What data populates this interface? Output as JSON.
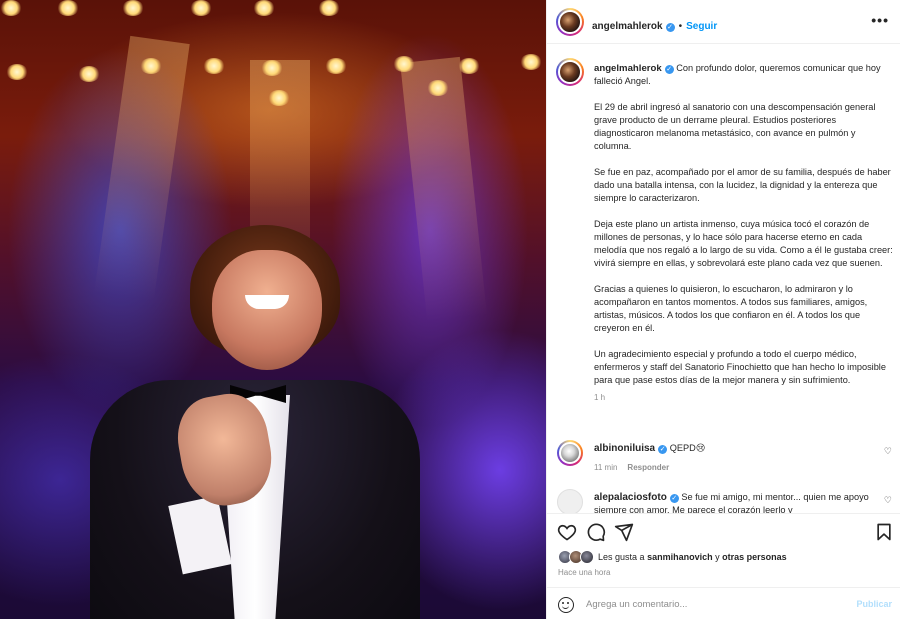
{
  "post": {
    "username": "angelmahlerok",
    "verified_icon": "verified-badge-icon",
    "separator": "•",
    "follow_label": "Seguir",
    "more_label": "•••"
  },
  "caption": {
    "username": "angelmahlerok",
    "paragraphs": [
      "Con profundo dolor, queremos comunicar que hoy falleció Angel.",
      "El 29 de abril ingresó al sanatorio con una descompensación general grave producto de un derrame pleural. Estudios posteriores diagnosticaron melanoma metastásico, con avance en pulmón y columna.",
      "Se fue en paz, acompañado por el amor de su familia, después de haber dado una batalla intensa, con la lucidez, la dignidad y la entereza que siempre lo caracterizaron.",
      "Deja este plano un artista inmenso, cuya música tocó el corazón de millones de personas, y lo hace sólo para hacerse eterno en cada melodía que nos regaló a lo largo de su vida. Como a él le gustaba creer: vivirá siempre en ellas, y sobrevolará este plano cada vez que suenen.",
      "Gracias a quienes lo quisieron, lo escucharon, lo admiraron y lo acompañaron en tantos momentos. A todos sus familiares, amigos, artistas, músicos. A todos los que confiaron en él. A todos los que creyeron en él.",
      "Un agradecimiento especial y profundo a todo el cuerpo médico, enfermeros y staff del Sanatorio Finochietto que han hecho lo imposible para que pase estos días de la mejor manera y sin sufrimiento."
    ],
    "time": "1 h"
  },
  "comments": [
    {
      "username": "albinoniluisa",
      "text": "QEPD😢",
      "time": "11 min",
      "reply_label": "Responder"
    },
    {
      "username": "alepalaciosfoto",
      "text": "Se fue mi amigo, mi mentor... quien me apoyo siempre con amor. Me parece el corazón leerlo y"
    }
  ],
  "likes": {
    "prefix": "Les gusta a",
    "user": "sanmihanovich",
    "connector": "y",
    "others": "otras personas",
    "posted": "Hace una hora"
  },
  "add_comment": {
    "placeholder": "Agrega un comentario...",
    "publish_label": "Publicar"
  },
  "colors": {
    "accent": "#0095f6",
    "verified": "#3897f0",
    "muted": "#8e8e8e",
    "publish_disabled": "#b2dffc"
  }
}
